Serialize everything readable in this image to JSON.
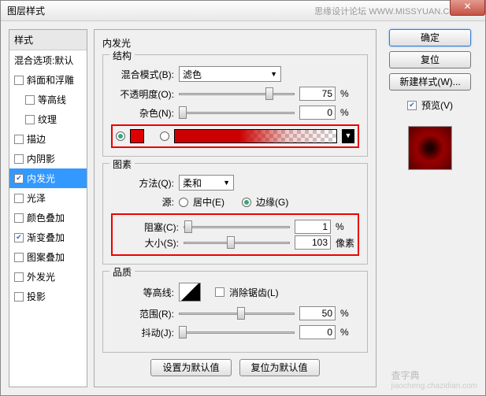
{
  "window": {
    "title": "图层样式",
    "watermark": "思缘设计论坛  WWW.MISSYUAN.COM"
  },
  "sidebar": {
    "header": "样式",
    "blend_default": "混合选项:默认",
    "items": [
      {
        "label": "斜面和浮雕",
        "checked": false
      },
      {
        "label": "等高线",
        "checked": false,
        "indent": true
      },
      {
        "label": "纹理",
        "checked": false,
        "indent": true
      },
      {
        "label": "描边",
        "checked": false
      },
      {
        "label": "内阴影",
        "checked": false
      },
      {
        "label": "内发光",
        "checked": true,
        "selected": true
      },
      {
        "label": "光泽",
        "checked": false
      },
      {
        "label": "颜色叠加",
        "checked": false
      },
      {
        "label": "渐变叠加",
        "checked": true
      },
      {
        "label": "图案叠加",
        "checked": false
      },
      {
        "label": "外发光",
        "checked": false
      },
      {
        "label": "投影",
        "checked": false
      }
    ]
  },
  "main": {
    "title": "内发光",
    "structure": {
      "legend": "结构",
      "blend_mode_label": "混合模式(B):",
      "blend_mode_value": "滤色",
      "opacity_label": "不透明度(O):",
      "opacity_value": "75",
      "opacity_unit": "%",
      "noise_label": "杂色(N):",
      "noise_value": "0",
      "noise_unit": "%"
    },
    "elements": {
      "legend": "图素",
      "technique_label": "方法(Q):",
      "technique_value": "柔和",
      "source_label": "源:",
      "source_center": "居中(E)",
      "source_edge": "边缘(G)",
      "choke_label": "阻塞(C):",
      "choke_value": "1",
      "choke_unit": "%",
      "size_label": "大小(S):",
      "size_value": "103",
      "size_unit": "像素"
    },
    "quality": {
      "legend": "品质",
      "contour_label": "等高线:",
      "antialias": "消除锯齿(L)",
      "range_label": "范围(R):",
      "range_value": "50",
      "range_unit": "%",
      "jitter_label": "抖动(J):",
      "jitter_value": "0",
      "jitter_unit": "%"
    },
    "footer": {
      "make_default": "设置为默认值",
      "reset_default": "复位为默认值"
    }
  },
  "buttons": {
    "ok": "确定",
    "cancel": "复位",
    "new_style": "新建样式(W)...",
    "preview": "预览(V)"
  },
  "page_watermark": {
    "line1": "查字典",
    "line2": "jiaocheng.chazidian.com"
  }
}
